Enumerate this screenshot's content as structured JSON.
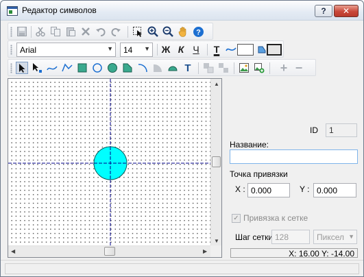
{
  "window": {
    "title": "Редактор символов"
  },
  "titlebar_buttons": {
    "help": "?",
    "close": "✕"
  },
  "toolbar_main": {
    "icons": [
      "save-icon",
      "cut-icon",
      "copy-icon",
      "paste-icon",
      "delete-icon",
      "undo-icon",
      "redo-icon",
      "select-icon",
      "zoom-in-icon",
      "zoom-out-icon",
      "pan-hand-icon",
      "help-icon"
    ]
  },
  "toolbar_format": {
    "font": "Arial",
    "size": "14",
    "bold": "Ж",
    "italic": "К",
    "underline": "Ч",
    "text_color": "T"
  },
  "side_panel": {
    "id_label": "ID",
    "id_value": "1",
    "name_label": "Название:",
    "name_value": "",
    "anchor_label": "Точка привязки",
    "x_label": "X :",
    "x_value": "0.000",
    "y_label": "Y :",
    "y_value": "0.000",
    "snap_label": "Привязка к сетке",
    "snap_checked": true,
    "grid_step_label": "Шаг сетки",
    "grid_step_value": "128",
    "unit_value": "Пиксел"
  },
  "status": {
    "coords": "X: 16.00  Y: -14.00"
  },
  "colors": {
    "circle_fill": "#00ffff",
    "axis": "#00008b",
    "accent": "#1c6fd1"
  }
}
